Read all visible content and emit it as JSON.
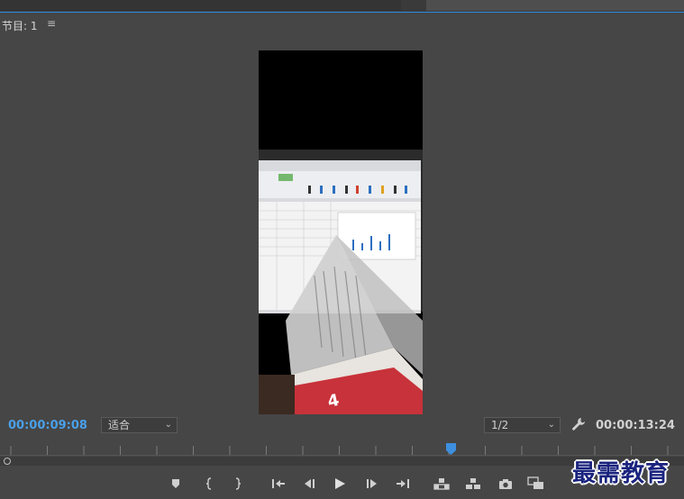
{
  "panel": {
    "title": "节目: 1",
    "menu_glyph": "≡"
  },
  "timecode": {
    "current": "00:00:09:08",
    "duration": "00:00:13:24"
  },
  "zoom_select": {
    "value": "适合"
  },
  "resolution_select": {
    "value": "1/2"
  },
  "icons": {
    "add_marker": "marker-icon",
    "mark_in": "mark-in-icon",
    "mark_out": "mark-out-icon",
    "go_to_in": "go-to-in-icon",
    "step_back": "step-back-icon",
    "play": "play-icon",
    "step_forward": "step-forward-icon",
    "go_to_out": "go-to-out-icon",
    "lift": "lift-icon",
    "extract": "extract-icon",
    "export_frame": "camera-icon",
    "comparison_view": "comparison-view-icon",
    "settings": "wrench-icon"
  },
  "colors": {
    "accent": "#2a8ce8",
    "timecode_blue": "#4a9fe8",
    "background": "#464646"
  },
  "playhead": {
    "position_fraction": 0.66
  },
  "watermark": {
    "text": "最需教育"
  }
}
